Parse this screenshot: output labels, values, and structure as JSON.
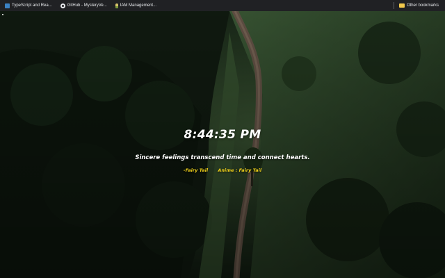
{
  "bookmarks_bar": {
    "items": [
      {
        "label": "TypeScript and Rea...",
        "icon": "typescript-icon"
      },
      {
        "label": "GitHub - MysteryVe...",
        "icon": "github-icon"
      },
      {
        "label": "IAM Management...",
        "icon": "iam-icon"
      }
    ],
    "other_bookmarks": {
      "label": "Other bookmarks",
      "icon": "folder-icon"
    }
  },
  "new_tab": {
    "clock": "8:44:35 PM",
    "quote": "Sincere feelings transcend time and connect hearts.",
    "character": "-Fairy Tail",
    "anime": "Anime : Fairy Tail"
  },
  "colors": {
    "bookmarks_bar_bg": "#202124",
    "clock_text": "#ffffff",
    "attribution_text": "#f2d21b"
  }
}
